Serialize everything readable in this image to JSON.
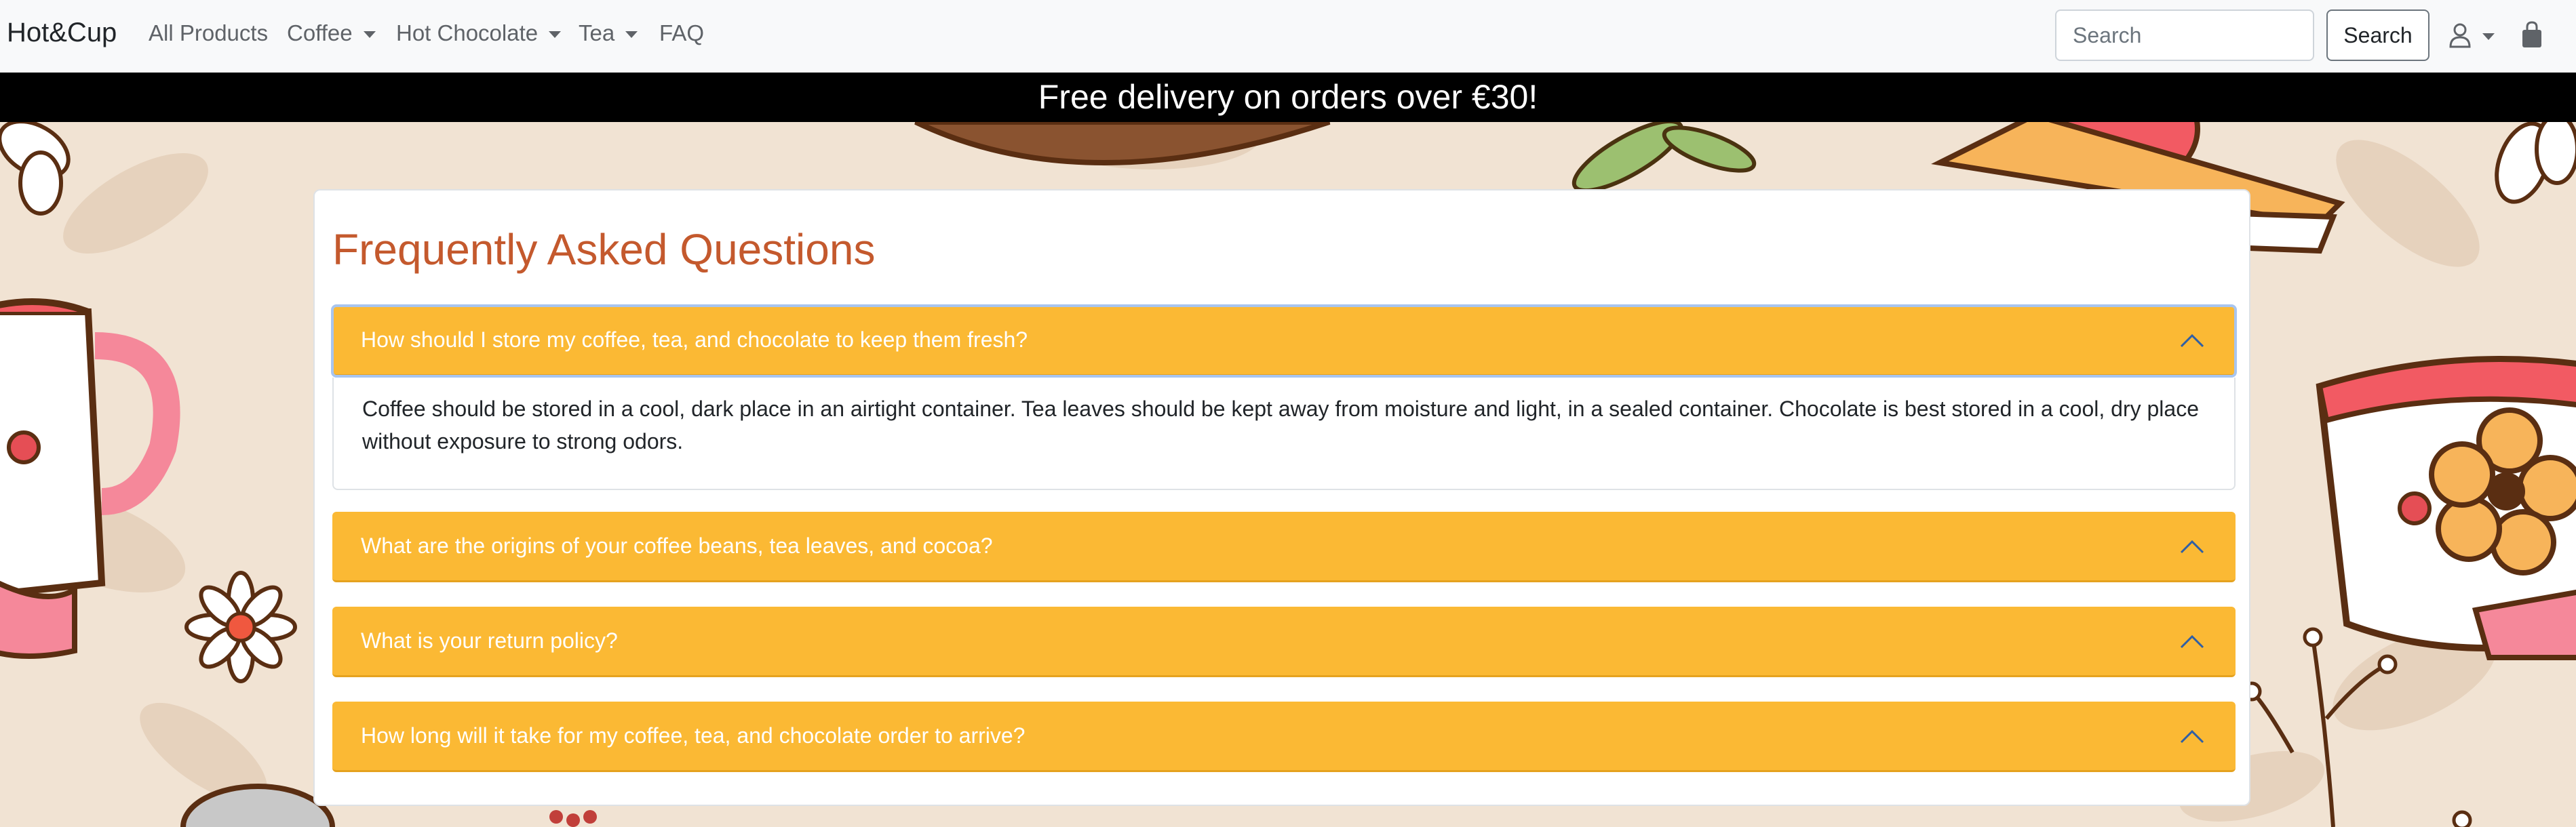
{
  "brand": "Hot&Cup",
  "nav": {
    "all_products": "All Products",
    "coffee": "Coffee",
    "hot_chocolate": "Hot Chocolate",
    "tea": "Tea",
    "faq": "FAQ"
  },
  "search": {
    "placeholder": "Search",
    "button_label": "Search"
  },
  "icons": {
    "user": "user-icon",
    "cart": "shopping-bag-icon",
    "chevron": "chevron-up-icon"
  },
  "promo": {
    "text": "Free delivery on orders over €30!"
  },
  "faq": {
    "title": "Frequently Asked Questions",
    "items": [
      {
        "question": "How should I store my coffee, tea, and chocolate to keep them fresh?",
        "answer": "Coffee should be stored in a cool, dark place in an airtight container. Tea leaves should be kept away from moisture and light, in a sealed container. Chocolate is best stored in a cool, dry place without exposure to strong odors.",
        "expanded": true
      },
      {
        "question": "What are the origins of your coffee beans, tea leaves, and cocoa?",
        "expanded": false
      },
      {
        "question": "What is your return policy?",
        "expanded": false
      },
      {
        "question": "How long will it take for my coffee, tea, and chocolate order to arrive?",
        "expanded": false
      }
    ]
  },
  "colors": {
    "accordion_header": "#fbb934",
    "title": "#c4592d",
    "promo_bg": "#000000",
    "page_bg": "#f1e3d3"
  }
}
